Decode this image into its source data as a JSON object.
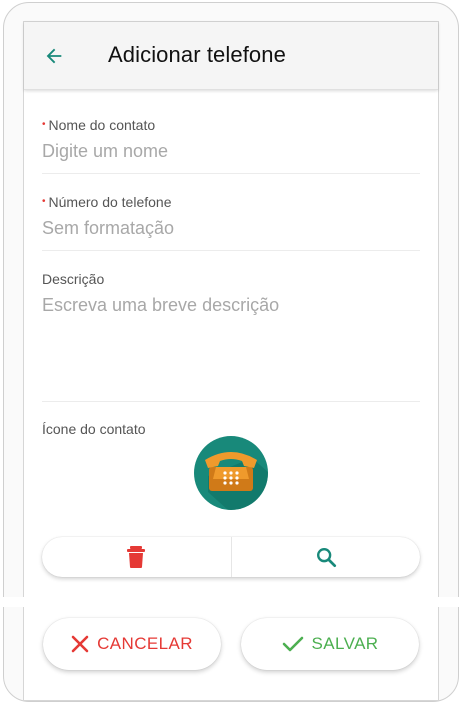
{
  "appbar": {
    "title": "Adicionar telefone"
  },
  "form": {
    "name": {
      "label": "Nome do contato",
      "placeholder": "Digite um nome",
      "required_marker": "•"
    },
    "phone": {
      "label": "Número do telefone",
      "placeholder": "Sem formatação",
      "required_marker": "•"
    },
    "description": {
      "label": "Descrição",
      "placeholder": "Escreva uma breve descrição"
    },
    "icon": {
      "label": "Ícone do contato",
      "icon_name": "telephone-icon"
    }
  },
  "icon_actions": {
    "delete_icon": "trash-icon",
    "search_icon": "search-icon"
  },
  "actions": {
    "cancel_label": "CANCELAR",
    "save_label": "SALVAR"
  },
  "colors": {
    "accent": "#18897a",
    "danger": "#e53935",
    "success": "#4caf50",
    "appbar_bg": "#f5f5f5"
  }
}
